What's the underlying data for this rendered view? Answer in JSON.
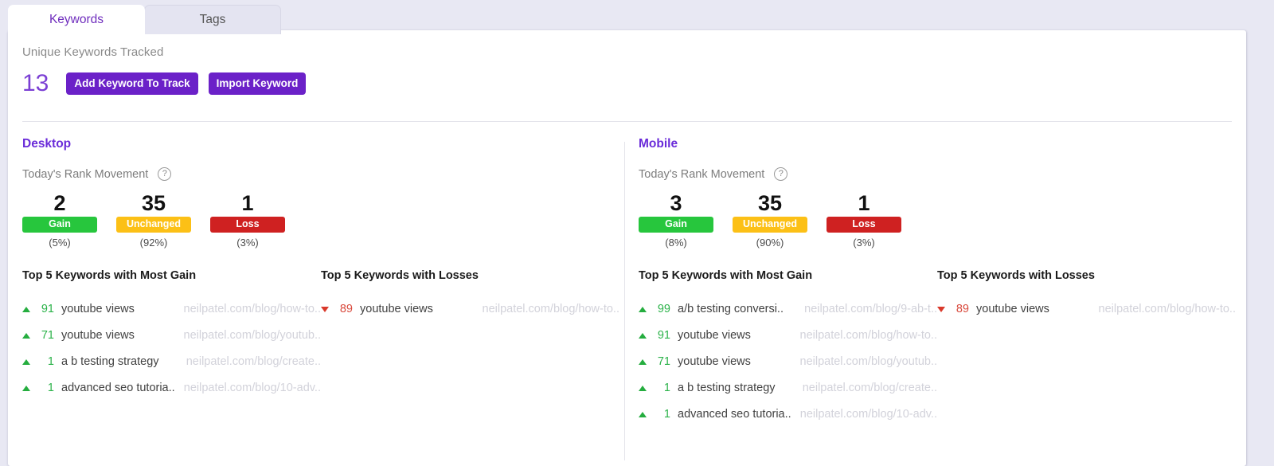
{
  "tabs": [
    {
      "label": "Keywords",
      "active": true
    },
    {
      "label": "Tags",
      "active": false
    }
  ],
  "header": {
    "unique_keywords_label": "Unique Keywords Tracked",
    "unique_keywords_count": "13",
    "add_keyword_button": "Add Keyword To Track",
    "import_keyword_button": "Import Keyword"
  },
  "help_icon_glyph": "?",
  "colors": {
    "accent_purple": "#6b21c8",
    "gain_green": "#27c63d",
    "unchanged_amber": "#fcc016",
    "loss_red": "#cf2121",
    "page_background": "#e8e8f3"
  },
  "panels": [
    {
      "title": "Desktop",
      "subhead": "Today's Rank Movement",
      "stats": [
        {
          "number": "2",
          "badge": "Gain",
          "percent": "(5%)"
        },
        {
          "number": "35",
          "badge": "Unchanged",
          "percent": "(92%)"
        },
        {
          "number": "1",
          "badge": "Loss",
          "percent": "(3%)"
        }
      ],
      "gain_title": "Top 5 Keywords with Most Gain",
      "gain_rows": [
        {
          "rank": "91",
          "term": "youtube views",
          "url": "neilpatel.com/blog/how-to.."
        },
        {
          "rank": "71",
          "term": "youtube views",
          "url": "neilpatel.com/blog/youtub.."
        },
        {
          "rank": "1",
          "term": "a b testing strategy",
          "url": "neilpatel.com/blog/create.."
        },
        {
          "rank": "1",
          "term": "advanced seo tutoria..",
          "url": "neilpatel.com/blog/10-adv.."
        }
      ],
      "loss_title": "Top 5 Keywords with Losses",
      "loss_rows": [
        {
          "rank": "89",
          "term": "youtube views",
          "url": "neilpatel.com/blog/how-to.."
        }
      ]
    },
    {
      "title": "Mobile",
      "subhead": "Today's Rank Movement",
      "stats": [
        {
          "number": "3",
          "badge": "Gain",
          "percent": "(8%)"
        },
        {
          "number": "35",
          "badge": "Unchanged",
          "percent": "(90%)"
        },
        {
          "number": "1",
          "badge": "Loss",
          "percent": "(3%)"
        }
      ],
      "gain_title": "Top 5 Keywords with Most Gain",
      "gain_rows": [
        {
          "rank": "99",
          "term": "a/b testing conversi..",
          "url": "neilpatel.com/blog/9-ab-t.."
        },
        {
          "rank": "91",
          "term": "youtube views",
          "url": "neilpatel.com/blog/how-to.."
        },
        {
          "rank": "71",
          "term": "youtube views",
          "url": "neilpatel.com/blog/youtub.."
        },
        {
          "rank": "1",
          "term": "a b testing strategy",
          "url": "neilpatel.com/blog/create.."
        },
        {
          "rank": "1",
          "term": "advanced seo tutoria..",
          "url": "neilpatel.com/blog/10-adv.."
        }
      ],
      "loss_title": "Top 5 Keywords with Losses",
      "loss_rows": [
        {
          "rank": "89",
          "term": "youtube views",
          "url": "neilpatel.com/blog/how-to.."
        }
      ]
    }
  ]
}
